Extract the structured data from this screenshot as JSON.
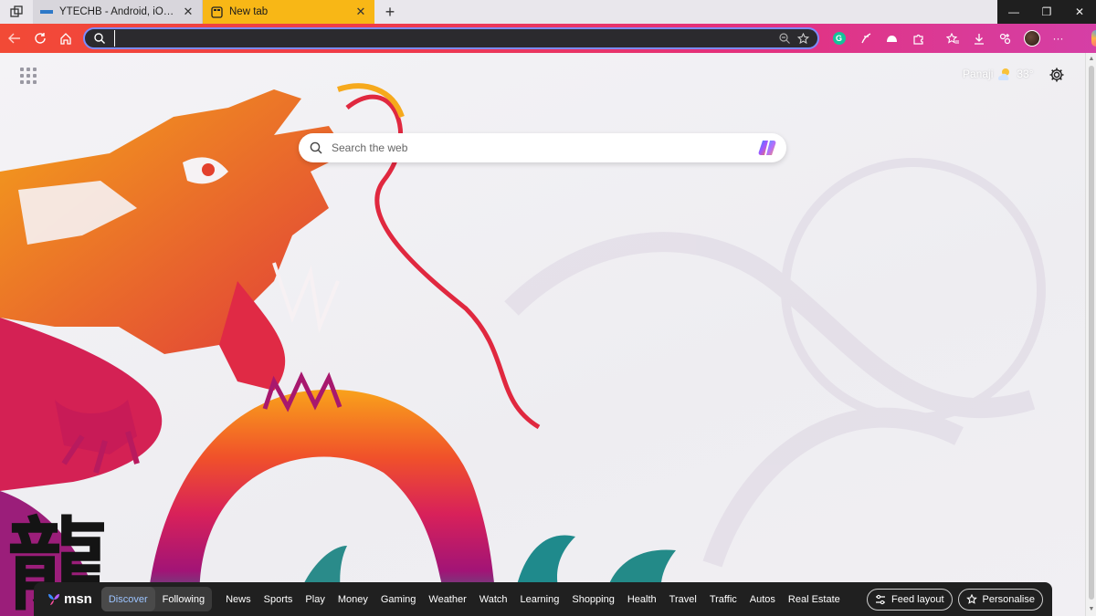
{
  "tabs": [
    {
      "title": "YTECHB - Android, iOS, Wallpapers",
      "active": false
    },
    {
      "title": "New tab",
      "active": true
    }
  ],
  "toolbar": {
    "address_value": "",
    "accent_color": "#f8b716"
  },
  "icons": {
    "workspaces": "workspaces-icon",
    "back": "back-arrow-icon",
    "refresh": "refresh-icon",
    "home": "home-icon",
    "search": "search-icon",
    "zoom": "zoom-icon",
    "favorite": "star-icon",
    "grammarly": "grammarly-icon",
    "extensions": "puzzle-icon",
    "favorites": "favorites-icon",
    "downloads": "download-icon",
    "more": "more-icon",
    "copilot": "copilot-icon",
    "settings": "gear-icon",
    "apps": "apps-grid-icon"
  },
  "extensions": {
    "grammarly_letter": "G",
    "more": "···"
  },
  "window_controls": {
    "minimize": "—",
    "maximize": "❐",
    "close": "✕"
  },
  "weather": {
    "location": "Panaji",
    "temp": "33°"
  },
  "search": {
    "placeholder": "Search the web"
  },
  "msn": {
    "logo": "msn",
    "tabs": [
      "Discover",
      "Following"
    ],
    "categories": [
      "News",
      "Sports",
      "Play",
      "Money",
      "Gaming",
      "Weather",
      "Watch",
      "Learning",
      "Shopping",
      "Health",
      "Travel",
      "Traffic",
      "Autos",
      "Real Estate"
    ],
    "feed_layout": "Feed layout",
    "personalise": "Personalise"
  }
}
